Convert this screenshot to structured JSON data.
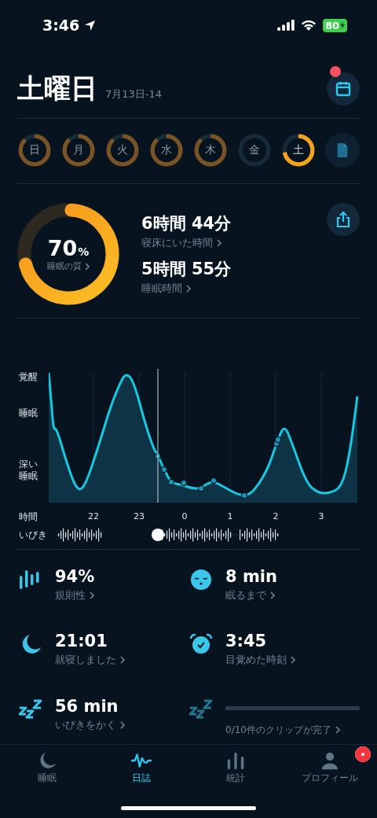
{
  "status_bar": {
    "time": "3:46",
    "battery": "80"
  },
  "header": {
    "title": "土曜日",
    "date_range": "7月13日-14",
    "calendar_notification": true
  },
  "days": [
    {
      "label": "日",
      "level": 0.88,
      "selected": false
    },
    {
      "label": "月",
      "level": 0.88,
      "selected": false
    },
    {
      "label": "火",
      "level": 0.88,
      "selected": false
    },
    {
      "label": "水",
      "level": 0.88,
      "selected": false
    },
    {
      "label": "木",
      "level": 0.88,
      "selected": false
    },
    {
      "label": "金",
      "level": 0,
      "selected": false
    },
    {
      "label": "土",
      "level": 0.72,
      "selected": true
    }
  ],
  "summary": {
    "quality": {
      "value": "70",
      "unit": "%",
      "label": "睡眠の質",
      "level": 0.7
    },
    "metrics": [
      {
        "value": "6時間 44分",
        "label": "寝床にいた時間"
      },
      {
        "value": "5時間 55分",
        "label": "睡眠時間"
      }
    ]
  },
  "sleep_graph": {
    "stage_labels": [
      "覚醒",
      "睡眠",
      "深い睡眠"
    ],
    "time_label": "時間",
    "time_ticks": [
      "22",
      "23",
      "0",
      "1",
      "2",
      "3"
    ],
    "snoring_label": "いびき"
  },
  "stats": [
    {
      "kind": "stat",
      "value": "94%",
      "label": "規則性"
    },
    {
      "kind": "stat",
      "value": "8 min",
      "label": "眠るまで"
    },
    {
      "kind": "stat",
      "value": "21:01",
      "label": "就寝しました"
    },
    {
      "kind": "stat",
      "value": "3:45",
      "label": "目覚めた時刻"
    },
    {
      "kind": "stat",
      "value": "56 min",
      "label": "いびきをかく"
    },
    {
      "kind": "clips",
      "level": 0,
      "label": "0/10件のクリップが完了"
    }
  ],
  "tabs": [
    {
      "label": "睡眠",
      "selected": false,
      "badge": false
    },
    {
      "label": "日誌",
      "selected": true,
      "badge": false
    },
    {
      "label": "統計",
      "selected": false,
      "badge": false
    },
    {
      "label": "プロフィール",
      "selected": false,
      "badge": true
    }
  ]
}
